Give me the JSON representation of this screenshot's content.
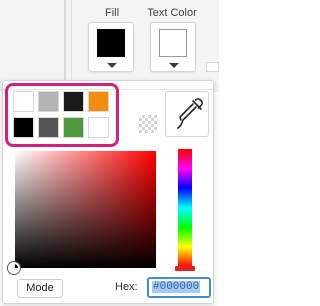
{
  "toolbar": {
    "fill_label": "Fill",
    "text_color_label": "Text Color",
    "fill_color": "#000000",
    "text_color": "#ffffff"
  },
  "palette": {
    "highlight_color": "#d6207f",
    "swatches": [
      "#ffffff",
      "#b3b3b3",
      "#1a1a1a",
      "#f28c0c",
      "#000000",
      "#555555",
      "#4f9a3e",
      "#ffffff"
    ]
  },
  "picker": {
    "base_hue_color": "#ff0000",
    "mode_label": "Mode",
    "hex_label": "Hex:",
    "hex_value": "#000000"
  },
  "icons": {
    "eyedropper": "eyedropper-icon",
    "transparent": "transparent-checker-icon"
  }
}
